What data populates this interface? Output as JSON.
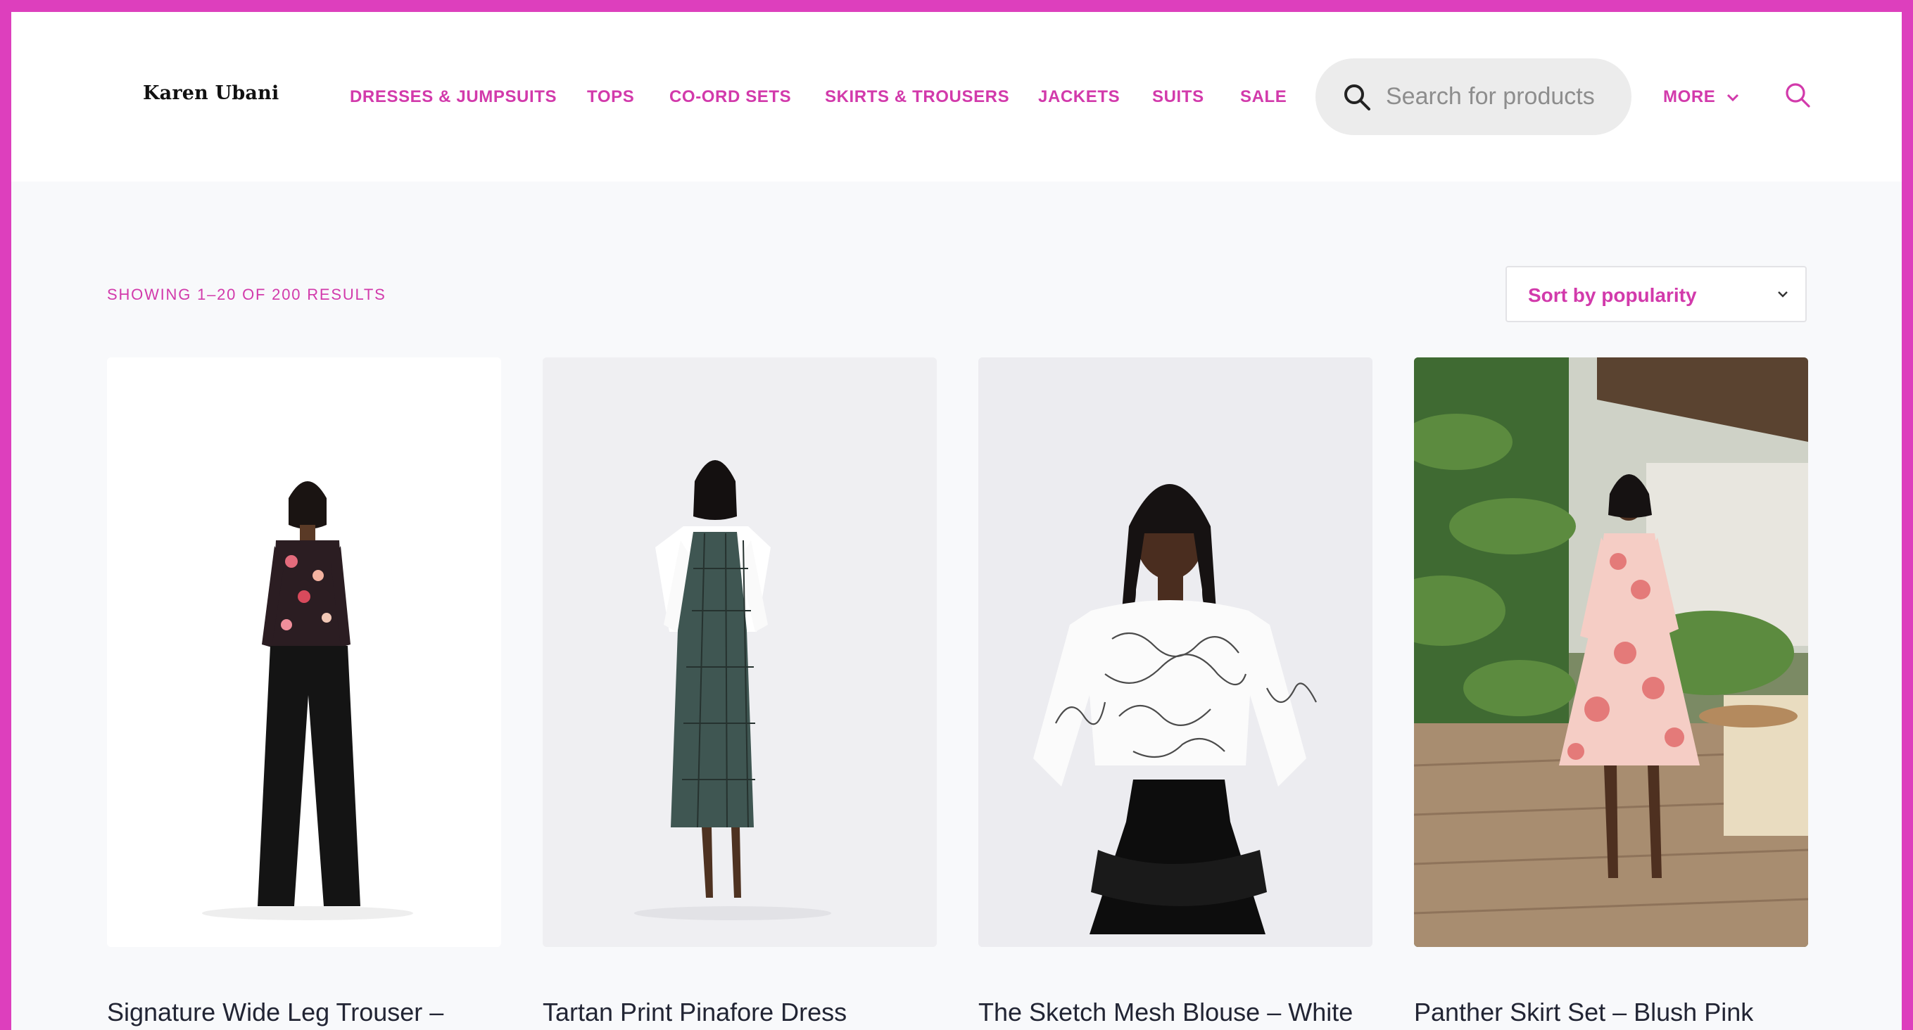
{
  "brand": {
    "logo_text": "Karen Ubani"
  },
  "nav": {
    "items": [
      {
        "label": "DRESSES & JUMPSUITS"
      },
      {
        "label": "TOPS"
      },
      {
        "label": "CO-ORD SETS"
      },
      {
        "label": "SKIRTS & TROUSERS"
      },
      {
        "label": "JACKETS"
      },
      {
        "label": "SUITS"
      },
      {
        "label": "SALE"
      }
    ],
    "more_label": "MORE"
  },
  "search": {
    "placeholder": "Search for products",
    "icon": "search-icon"
  },
  "shop": {
    "results_count": "SHOWING 1–20 OF 200 RESULTS",
    "sort_label": "Sort by popularity"
  },
  "products": [
    {
      "title": "Signature Wide Leg Trouser – Black",
      "image": "model in floral top and black wide-leg trousers"
    },
    {
      "title": "Tartan Print Pinafore Dress",
      "image": "model in green tartan pinafore dress over white shirt"
    },
    {
      "title": "The Sketch Mesh Blouse – White",
      "image": "model in white sketch-print mesh blouse and black skirt"
    },
    {
      "title": "Panther Skirt Set – Blush Pink Floral",
      "image": "model in blush pink floral skirt set on a terrace"
    }
  ],
  "colors": {
    "accent": "#d23aab",
    "border_frame": "#dd3fbd",
    "page_bg": "#f8f9fb",
    "header_bg": "#ffffff",
    "title_text": "#222534"
  }
}
